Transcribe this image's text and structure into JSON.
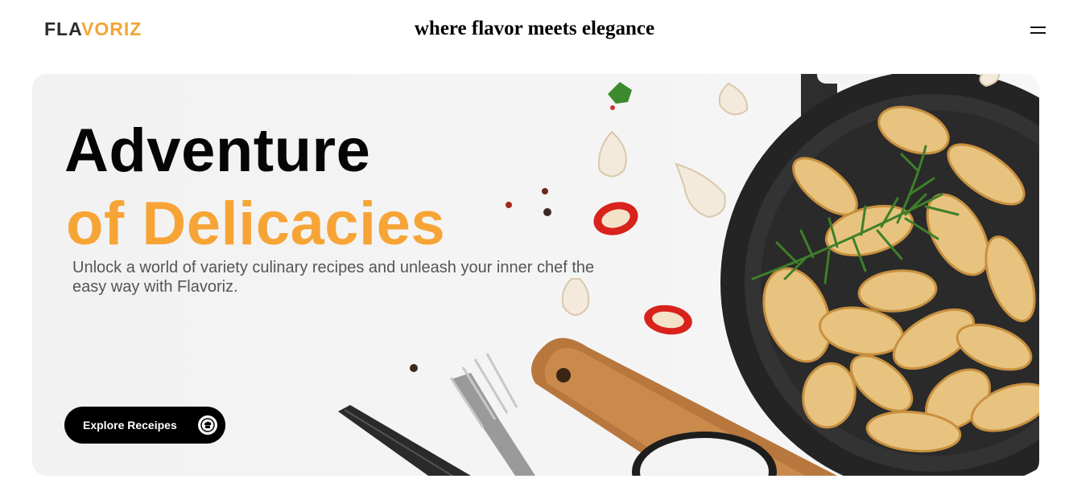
{
  "header": {
    "logo_part1": "FLA",
    "logo_part2": "VORIZ",
    "tagline": "where flavor meets elegance",
    "menu_icon": "hamburger-menu-icon"
  },
  "hero": {
    "title_line1": "Adventure",
    "title_line2": "of Delicacies",
    "description": "Unlock a world of variety culinary recipes and unleash your inner chef the easy way with Flavoriz.",
    "cta_label": "Explore Receipes",
    "cta_icon": "chef-hat-icon",
    "image_subject": "skillet-potato-wedges-icon"
  },
  "colors": {
    "accent": "#f7a436",
    "dark": "#000000",
    "background": "#ffffff",
    "hero_background": "#f3f3f3"
  }
}
